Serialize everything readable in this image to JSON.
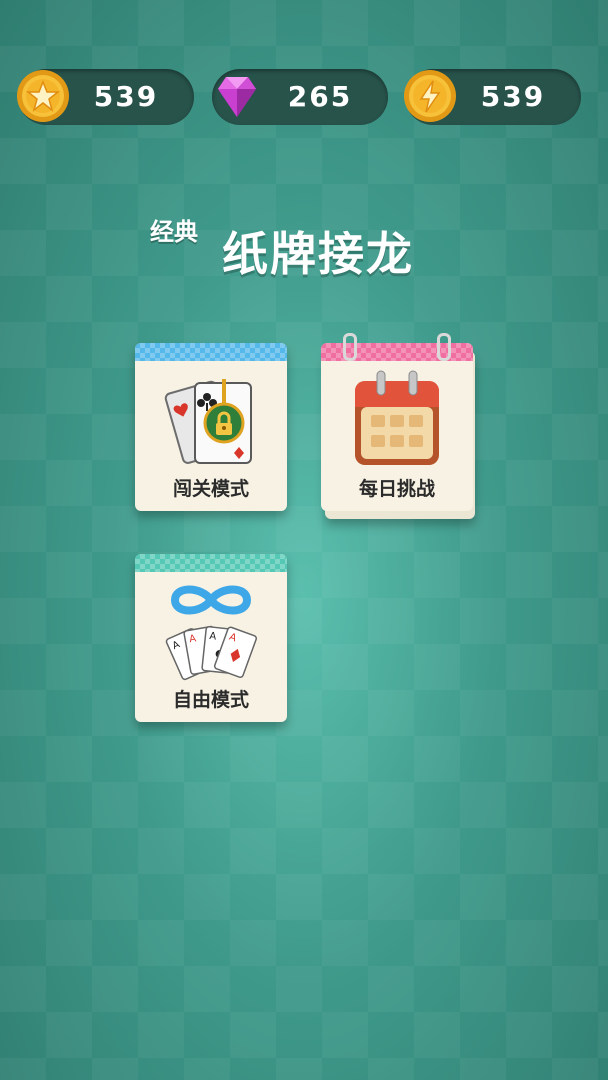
{
  "currency": {
    "coins": "539",
    "gems": "265",
    "energy": "539"
  },
  "title": {
    "small": "经典",
    "big": "纸牌接龙"
  },
  "modes": {
    "level": "闯关模式",
    "daily": "每日挑战",
    "free": "自由模式"
  },
  "colors": {
    "coin": "#f5b52b",
    "gem": "#d13fd1",
    "level_band": "#55b8ea",
    "daily_band": "#f06fa0",
    "free_band": "#55c9b6"
  }
}
